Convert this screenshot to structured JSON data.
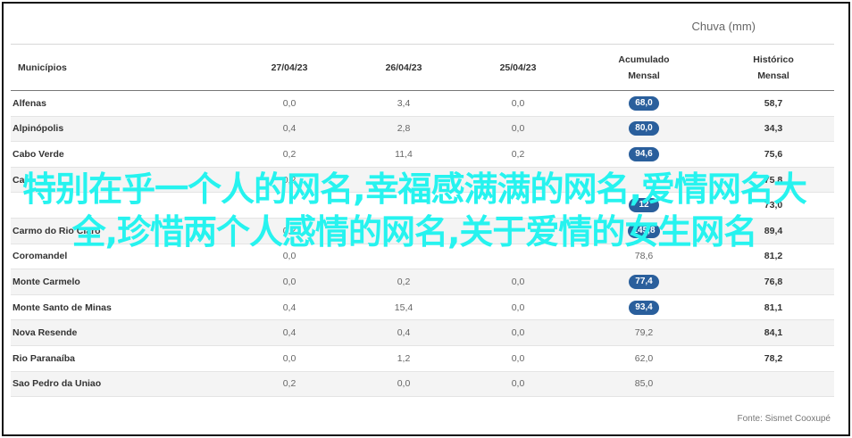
{
  "unit_label": "Chuva (mm)",
  "headers": {
    "name": "Municípios",
    "d1": "27/04/23",
    "d2": "26/04/23",
    "d3": "25/04/23",
    "acc": "Acumulado\nMensal",
    "hist": "Histórico\nMensal"
  },
  "rows": [
    {
      "name": "Alfenas",
      "d1": "0,0",
      "d2": "3,4",
      "d3": "0,0",
      "acc": "68,0",
      "acc_highlight": true,
      "hist": "58,7"
    },
    {
      "name": "Alpinópolis",
      "d1": "0,4",
      "d2": "2,8",
      "d3": "0,0",
      "acc": "80,0",
      "acc_highlight": true,
      "hist": "34,3"
    },
    {
      "name": "Cabo Verde",
      "d1": "0,2",
      "d2": "11,4",
      "d3": "0,2",
      "acc": "94,6",
      "acc_highlight": true,
      "hist": "75,6"
    },
    {
      "name": "Ca",
      "d1": "0,2",
      "d2": "",
      "d3": "",
      "acc": "",
      "acc_highlight": false,
      "hist": "75,8"
    },
    {
      "name": "",
      "d1": "",
      "d2": "",
      "d3": "",
      "acc": "12",
      "acc_highlight": true,
      "hist": "73,0"
    },
    {
      "name": "Carmo do Rio Claro",
      "d1": "0,2",
      "d2": "",
      "d3": "",
      "acc": "145,8",
      "acc_highlight": true,
      "hist": "89,4"
    },
    {
      "name": "Coromandel",
      "d1": "0,0",
      "d2": "",
      "d3": "",
      "acc": "78,6",
      "acc_highlight": false,
      "hist": "81,2"
    },
    {
      "name": "Monte Carmelo",
      "d1": "0,0",
      "d2": "0,2",
      "d3": "0,0",
      "acc": "77,4",
      "acc_highlight": true,
      "hist": "76,8"
    },
    {
      "name": "Monte Santo de Minas",
      "d1": "0,4",
      "d2": "15,4",
      "d3": "0,0",
      "acc": "93,4",
      "acc_highlight": true,
      "hist": "81,1"
    },
    {
      "name": "Nova Resende",
      "d1": "0,4",
      "d2": "0,4",
      "d3": "0,0",
      "acc": "79,2",
      "acc_highlight": false,
      "hist": "84,1"
    },
    {
      "name": "Rio Paranaíba",
      "d1": "0,0",
      "d2": "1,2",
      "d3": "0,0",
      "acc": "62,0",
      "acc_highlight": false,
      "hist": "78,2"
    },
    {
      "name": "Sao Pedro da Uniao",
      "d1": "0,2",
      "d2": "0,0",
      "d3": "0,0",
      "acc": "85,0",
      "acc_highlight": false,
      "hist": ""
    }
  ],
  "source": "Fonte: Sismet Cooxupé",
  "overlay_text": "特别在乎一个人的网名,幸福感满满的网名,爱情网名大全,珍惜两个人感情的网名,关于爱情的女生网名",
  "colors": {
    "pill": "#2a5f9c",
    "overlay": "#26f3ef"
  }
}
